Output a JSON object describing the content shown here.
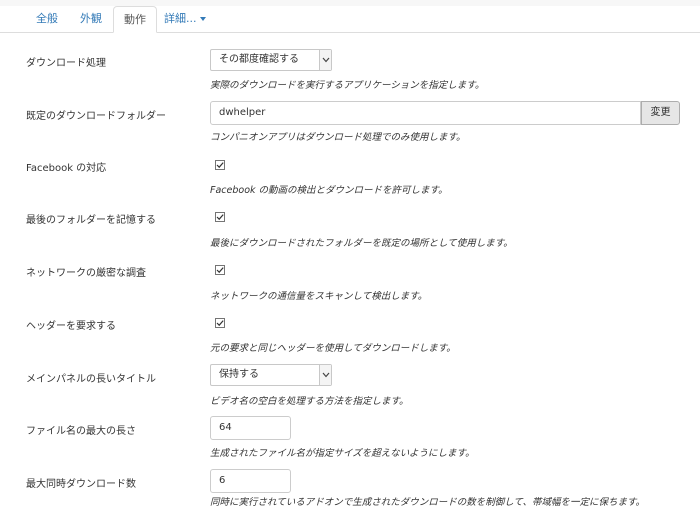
{
  "tabs": [
    {
      "label": "全般"
    },
    {
      "label": "外観"
    },
    {
      "label": "動作"
    },
    {
      "label": "詳細..."
    }
  ],
  "settings": {
    "download_processing": {
      "label": "ダウンロード処理",
      "value": "その都度確認する",
      "help": "実際のダウンロードを実行するアプリケーションを指定します。"
    },
    "default_folder": {
      "label": "既定のダウンロードフォルダー",
      "value": "dwhelper",
      "button": "変更",
      "help": "コンパニオンアプリはダウンロード処理でのみ使用します。"
    },
    "facebook": {
      "label": "Facebook の対応",
      "checked": true,
      "help": "Facebook の動画の検出とダウンロードを許可します。"
    },
    "remember_folder": {
      "label": "最後のフォルダーを記憶する",
      "checked": true,
      "help": "最後にダウンロードされたフォルダーを既定の場所として使用します。"
    },
    "network_probe": {
      "label": "ネットワークの厳密な調査",
      "checked": true,
      "help": "ネットワークの通信量をスキャンして検出します。"
    },
    "request_headers": {
      "label": "ヘッダーを要求する",
      "checked": true,
      "help": "元の要求と同じヘッダーを使用してダウンロードします。"
    },
    "long_title": {
      "label": "メインパネルの長いタイトル",
      "value": "保持する",
      "help": "ビデオ名の空白を処理する方法を指定します。"
    },
    "max_filename": {
      "label": "ファイル名の最大の長さ",
      "value": "64",
      "help": "生成されたファイル名が指定サイズを超えないようにします。"
    },
    "max_downloads": {
      "label": "最大同時ダウンロード数",
      "value": "6",
      "help": "同時に実行されているアドオンで生成されたダウンロードの数を制御して、帯域幅を一定に保ちます。"
    }
  }
}
